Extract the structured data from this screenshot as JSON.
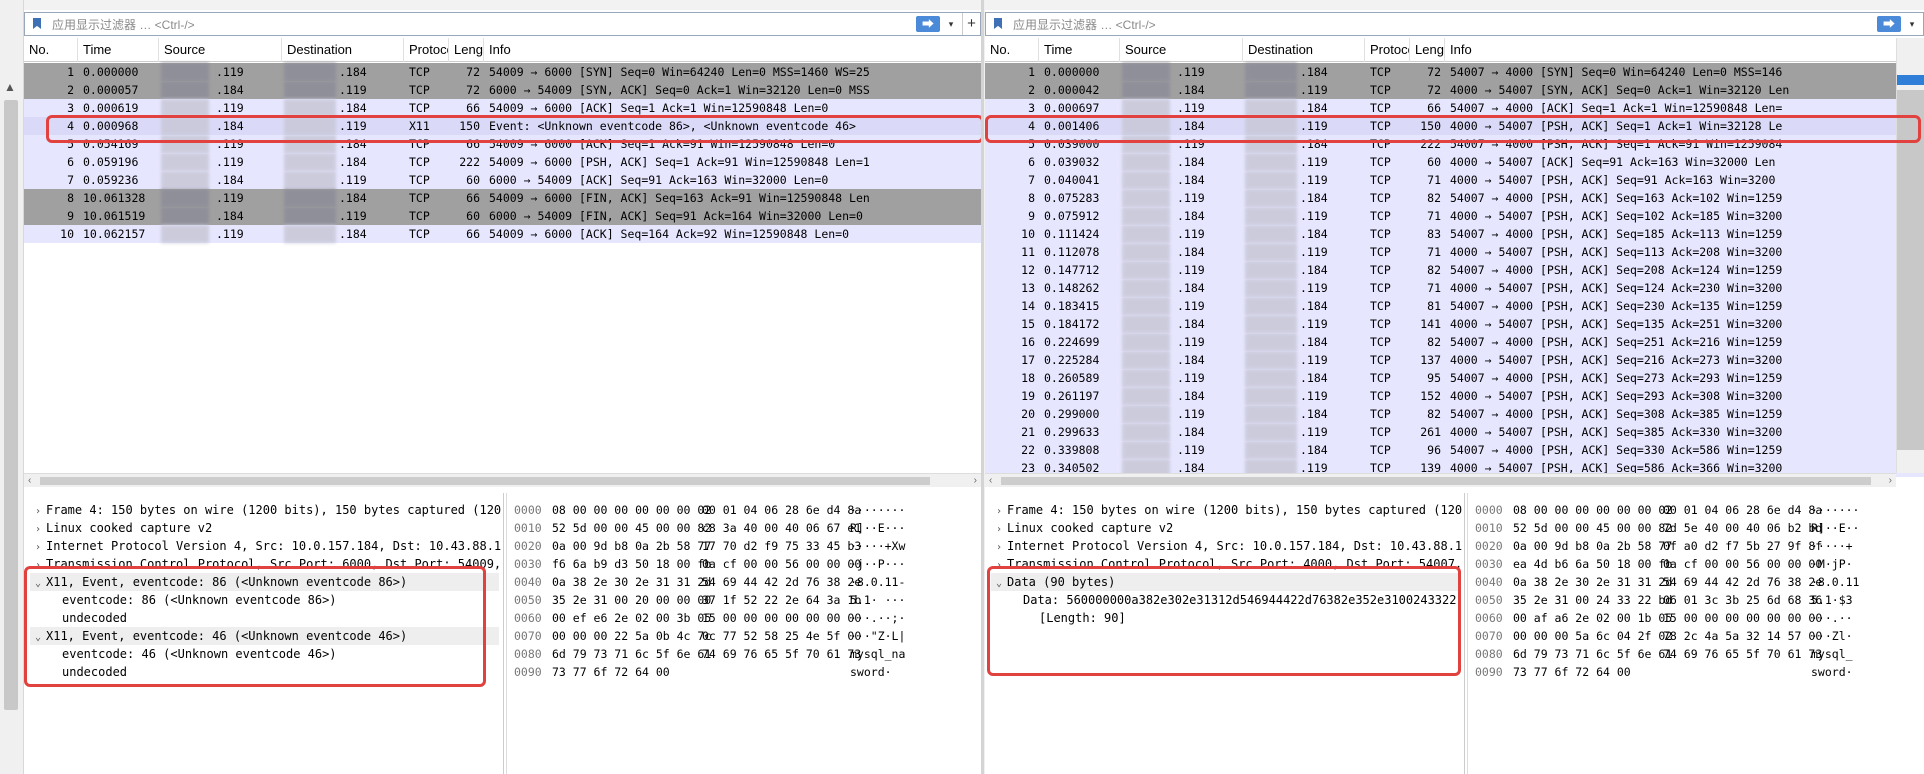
{
  "filter": {
    "placeholder": "应用显示过滤器 … <Ctrl-/>",
    "go_label": "⮕",
    "dropdown_label": "▾",
    "plus_label": "+"
  },
  "columns": [
    "No.",
    "Time",
    "Source",
    "Destination",
    "Protoco",
    "Lengt",
    "Info"
  ],
  "left_packets": [
    {
      "no": "1",
      "time": "0.000000",
      "src": ".119",
      "dst": ".184",
      "proto": "TCP",
      "len": "72",
      "info": "54009 → 6000 [SYN] Seq=0 Win=64240 Len=0 MSS=1460 WS=25",
      "style": "fin"
    },
    {
      "no": "2",
      "time": "0.000057",
      "src": ".184",
      "dst": ".119",
      "proto": "TCP",
      "len": "72",
      "info": "6000 → 54009 [SYN, ACK] Seq=0 Ack=1 Win=32120 Len=0 MSS",
      "style": "fin"
    },
    {
      "no": "3",
      "time": "0.000619",
      "src": ".119",
      "dst": ".184",
      "proto": "TCP",
      "len": "66",
      "info": "54009 → 6000 [ACK] Seq=1 Ack=1 Win=12590848 Len=0",
      "style": "tcp"
    },
    {
      "no": "4",
      "time": "0.000968",
      "src": ".184",
      "dst": ".119",
      "proto": "X11",
      "len": "150",
      "info": "Event: <Unknown eventcode 86>, <Unknown eventcode 46>",
      "style": "x11"
    },
    {
      "no": "5",
      "time": "0.054169",
      "src": ".119",
      "dst": ".184",
      "proto": "TCP",
      "len": "66",
      "info": "54009 → 6000 [ACK] Seq=1 Ack=91 Win=12590848 Len=0",
      "style": "tcp"
    },
    {
      "no": "6",
      "time": "0.059196",
      "src": ".119",
      "dst": ".184",
      "proto": "TCP",
      "len": "222",
      "info": "54009 → 6000 [PSH, ACK] Seq=1 Ack=91 Win=12590848 Len=1",
      "style": "tcp"
    },
    {
      "no": "7",
      "time": "0.059236",
      "src": ".184",
      "dst": ".119",
      "proto": "TCP",
      "len": "60",
      "info": "6000 → 54009 [ACK] Seq=91 Ack=163 Win=32000 Len=0",
      "style": "tcp"
    },
    {
      "no": "8",
      "time": "10.061328",
      "src": ".119",
      "dst": ".184",
      "proto": "TCP",
      "len": "66",
      "info": "54009 → 6000 [FIN, ACK] Seq=163 Ack=91 Win=12590848 Len",
      "style": "fin"
    },
    {
      "no": "9",
      "time": "10.061519",
      "src": ".184",
      "dst": ".119",
      "proto": "TCP",
      "len": "60",
      "info": "6000 → 54009 [FIN, ACK] Seq=91 Ack=164 Win=32000 Len=0",
      "style": "fin"
    },
    {
      "no": "10",
      "time": "10.062157",
      "src": ".119",
      "dst": ".184",
      "proto": "TCP",
      "len": "66",
      "info": "54009 → 6000 [ACK] Seq=164 Ack=92 Win=12590848 Len=0",
      "style": "tcp"
    }
  ],
  "right_packets": [
    {
      "no": "1",
      "time": "0.000000",
      "src": ".119",
      "dst": ".184",
      "proto": "TCP",
      "len": "72",
      "info": "54007 → 4000 [SYN] Seq=0 Win=64240 Len=0 MSS=146",
      "style": "fin"
    },
    {
      "no": "2",
      "time": "0.000042",
      "src": ".184",
      "dst": ".119",
      "proto": "TCP",
      "len": "72",
      "info": "4000 → 54007 [SYN, ACK] Seq=0 Ack=1 Win=32120 Len",
      "style": "fin"
    },
    {
      "no": "3",
      "time": "0.000697",
      "src": ".119",
      "dst": ".184",
      "proto": "TCP",
      "len": "66",
      "info": "54007 → 4000 [ACK] Seq=1 Ack=1 Win=12590848 Len=",
      "style": "tcp"
    },
    {
      "no": "4",
      "time": "0.001406",
      "src": ".184",
      "dst": ".119",
      "proto": "TCP",
      "len": "150",
      "info": "4000 → 54007 [PSH, ACK] Seq=1 Ack=1 Win=32128 Le",
      "style": "sel"
    },
    {
      "no": "5",
      "time": "0.039000",
      "src": ".119",
      "dst": ".184",
      "proto": "TCP",
      "len": "222",
      "info": "54007 → 4000 [PSH, ACK] Seq=1 Ack=91 Win=1259084",
      "style": "tcp"
    },
    {
      "no": "6",
      "time": "0.039032",
      "src": ".184",
      "dst": ".119",
      "proto": "TCP",
      "len": "60",
      "info": "4000 → 54007 [ACK] Seq=91 Ack=163 Win=32000 Len",
      "style": "tcp"
    },
    {
      "no": "7",
      "time": "0.040041",
      "src": ".184",
      "dst": ".119",
      "proto": "TCP",
      "len": "71",
      "info": "4000 → 54007 [PSH, ACK] Seq=91 Ack=163 Win=3200",
      "style": "tcp"
    },
    {
      "no": "8",
      "time": "0.075283",
      "src": ".119",
      "dst": ".184",
      "proto": "TCP",
      "len": "82",
      "info": "54007 → 4000 [PSH, ACK] Seq=163 Ack=102 Win=1259",
      "style": "tcp"
    },
    {
      "no": "9",
      "time": "0.075912",
      "src": ".184",
      "dst": ".119",
      "proto": "TCP",
      "len": "71",
      "info": "4000 → 54007 [PSH, ACK] Seq=102 Ack=185 Win=3200",
      "style": "tcp"
    },
    {
      "no": "10",
      "time": "0.111424",
      "src": ".119",
      "dst": ".184",
      "proto": "TCP",
      "len": "83",
      "info": "54007 → 4000 [PSH, ACK] Seq=185 Ack=113 Win=1259",
      "style": "tcp"
    },
    {
      "no": "11",
      "time": "0.112078",
      "src": ".184",
      "dst": ".119",
      "proto": "TCP",
      "len": "71",
      "info": "4000 → 54007 [PSH, ACK] Seq=113 Ack=208 Win=3200",
      "style": "tcp"
    },
    {
      "no": "12",
      "time": "0.147712",
      "src": ".119",
      "dst": ".184",
      "proto": "TCP",
      "len": "82",
      "info": "54007 → 4000 [PSH, ACK] Seq=208 Ack=124 Win=1259",
      "style": "tcp"
    },
    {
      "no": "13",
      "time": "0.148262",
      "src": ".184",
      "dst": ".119",
      "proto": "TCP",
      "len": "71",
      "info": "4000 → 54007 [PSH, ACK] Seq=124 Ack=230 Win=3200",
      "style": "tcp"
    },
    {
      "no": "14",
      "time": "0.183415",
      "src": ".119",
      "dst": ".184",
      "proto": "TCP",
      "len": "81",
      "info": "54007 → 4000 [PSH, ACK] Seq=230 Ack=135 Win=1259",
      "style": "tcp"
    },
    {
      "no": "15",
      "time": "0.184172",
      "src": ".184",
      "dst": ".119",
      "proto": "TCP",
      "len": "141",
      "info": "4000 → 54007 [PSH, ACK] Seq=135 Ack=251 Win=3200",
      "style": "tcp"
    },
    {
      "no": "16",
      "time": "0.224699",
      "src": ".119",
      "dst": ".184",
      "proto": "TCP",
      "len": "82",
      "info": "54007 → 4000 [PSH, ACK] Seq=251 Ack=216 Win=1259",
      "style": "tcp"
    },
    {
      "no": "17",
      "time": "0.225284",
      "src": ".184",
      "dst": ".119",
      "proto": "TCP",
      "len": "137",
      "info": "4000 → 54007 [PSH, ACK] Seq=216 Ack=273 Win=3200",
      "style": "tcp"
    },
    {
      "no": "18",
      "time": "0.260589",
      "src": ".119",
      "dst": ".184",
      "proto": "TCP",
      "len": "95",
      "info": "54007 → 4000 [PSH, ACK] Seq=273 Ack=293 Win=1259",
      "style": "tcp"
    },
    {
      "no": "19",
      "time": "0.261197",
      "src": ".184",
      "dst": ".119",
      "proto": "TCP",
      "len": "152",
      "info": "4000 → 54007 [PSH, ACK] Seq=293 Ack=308 Win=3200",
      "style": "tcp"
    },
    {
      "no": "20",
      "time": "0.299000",
      "src": ".119",
      "dst": ".184",
      "proto": "TCP",
      "len": "82",
      "info": "54007 → 4000 [PSH, ACK] Seq=308 Ack=385 Win=1259",
      "style": "tcp"
    },
    {
      "no": "21",
      "time": "0.299633",
      "src": ".184",
      "dst": ".119",
      "proto": "TCP",
      "len": "261",
      "info": "4000 → 54007 [PSH, ACK] Seq=385 Ack=330 Win=3200",
      "style": "tcp"
    },
    {
      "no": "22",
      "time": "0.339808",
      "src": ".119",
      "dst": ".184",
      "proto": "TCP",
      "len": "96",
      "info": "54007 → 4000 [PSH, ACK] Seq=330 Ack=586 Win=1259",
      "style": "tcp"
    },
    {
      "no": "23",
      "time": "0.340502",
      "src": ".184",
      "dst": ".119",
      "proto": "TCP",
      "len": "139",
      "info": "4000 → 54007 [PSH, ACK] Seq=586 Ack=366 Win=3200",
      "style": "tcp"
    }
  ],
  "left_detail": [
    {
      "tw": "›",
      "text": "Frame 4: 150 bytes on wire (1200 bits), 150 bytes captured (120",
      "indent": 0
    },
    {
      "tw": "›",
      "text": "Linux cooked capture v2",
      "indent": 0
    },
    {
      "tw": "›",
      "text": "Internet Protocol Version 4, Src: 10.0.157.184, Dst: 10.43.88.1",
      "indent": 0
    },
    {
      "tw": "›",
      "text": "Transmission Control Protocol, Src Port: 6000, Dst Port: 54009,",
      "indent": 0
    },
    {
      "tw": "⌄",
      "text": "X11, Event, eventcode: 86 (<Unknown eventcode 86>)",
      "indent": 0,
      "shade": true
    },
    {
      "tw": "",
      "text": "eventcode: 86 (<Unknown eventcode 86>)",
      "indent": 1
    },
    {
      "tw": "",
      "text": "undecoded",
      "indent": 1
    },
    {
      "tw": "⌄",
      "text": "X11, Event, eventcode: 46 (<Unknown eventcode 46>)",
      "indent": 0,
      "shade": true
    },
    {
      "tw": "",
      "text": "eventcode: 46 (<Unknown eventcode 46>)",
      "indent": 1
    },
    {
      "tw": "",
      "text": "undecoded",
      "indent": 1
    }
  ],
  "right_detail": [
    {
      "tw": "›",
      "text": "Frame 4: 150 bytes on wire (1200 bits), 150 bytes captured (120",
      "indent": 0
    },
    {
      "tw": "›",
      "text": "Linux cooked capture v2",
      "indent": 0
    },
    {
      "tw": "›",
      "text": "Internet Protocol Version 4, Src: 10.0.157.184, Dst: 10.43.88.1",
      "indent": 0
    },
    {
      "tw": "›",
      "text": "Transmission Control Protocol, Src Port: 4000, Dst Port: 54007,",
      "indent": 0
    },
    {
      "tw": "⌄",
      "text": "Data (90 bytes)",
      "indent": 0,
      "shade": true
    },
    {
      "tw": "",
      "text": "Data: 560000000a382e302e31312d546944422d76382e352e3100243322",
      "indent": 1
    },
    {
      "tw": "",
      "text": "[Length: 90]",
      "indent": 2
    }
  ],
  "left_hex": [
    {
      "off": "0000",
      "a": "08 00 00 00 00 00 00 02",
      "b": "00 01 04 06 28 6e d4 8a",
      "asc": "········"
    },
    {
      "off": "0010",
      "a": "52 5d 00 00 45 00 00 82",
      "b": "c8 3a 40 00 40 06 67 e1",
      "asc": "R]··E···"
    },
    {
      "off": "0020",
      "a": "0a 00 9d b8 0a 2b 58 77",
      "b": "17 70 d2 f9 75 33 45 b3",
      "asc": "·····+Xw"
    },
    {
      "off": "0030",
      "a": "f6 6a b9 d3 50 18 00 fb",
      "b": "0a cf 00 00 56 00 00 00",
      "asc": "·j··P···"
    },
    {
      "off": "0040",
      "a": "0a 38 2e 30 2e 31 31 2d",
      "b": "54 69 44 42 2d 76 38 2e",
      "asc": "·8.0.11-"
    },
    {
      "off": "0050",
      "a": "35 2e 31 00 20 00 00 00",
      "b": "37 1f 52 22 2e 64 3a 1b",
      "asc": "5.1· ···"
    },
    {
      "off": "0060",
      "a": "00 ef e6 2e 02 00 3b 05",
      "b": "15 00 00 00 00 00 00 00",
      "asc": "···.··;·"
    },
    {
      "off": "0070",
      "a": "00 00 00 22 5a 0b 4c 7c",
      "b": "0c 77 52 58 25 4e 5f 00",
      "asc": "···\"Z·L|"
    },
    {
      "off": "0080",
      "a": "6d 79 73 71 6c 5f 6e 61",
      "b": "74 69 76 65 5f 70 61 73",
      "asc": "mysql_na"
    },
    {
      "off": "0090",
      "a": "73 77 6f 72 64 00",
      "b": "",
      "asc": "sword·"
    }
  ],
  "right_hex": [
    {
      "off": "0000",
      "a": "08 00 00 00 00 00 00 02",
      "b": "00 01 04 06 28 6e d4 8a",
      "asc": "·······"
    },
    {
      "off": "0010",
      "a": "52 5d 00 00 45 00 00 82",
      "b": "7d 5e 40 00 40 06 b2 bd",
      "asc": "R]··E··"
    },
    {
      "off": "0020",
      "a": "0a 00 9d b8 0a 2b 58 77",
      "b": "0f a0 d2 f7 5b 27 9f 8f",
      "asc": "·····+"
    },
    {
      "off": "0030",
      "a": "ea 4d b6 6a 50 18 00 fb",
      "b": "0a cf 00 00 56 00 00 00",
      "asc": "·M·jP·"
    },
    {
      "off": "0040",
      "a": "0a 38 2e 30 2e 31 31 2d",
      "b": "54 69 44 42 2d 76 38 2e",
      "asc": "·8.0.11"
    },
    {
      "off": "0050",
      "a": "35 2e 31 00 24 33 22 bd",
      "b": "06 01 3c 3b 25 6d 68 36",
      "asc": "5.1·$3"
    },
    {
      "off": "0060",
      "a": "00 af a6 2e 02 00 1b 05",
      "b": "15 00 00 00 00 00 00 00",
      "asc": "···.··"
    },
    {
      "off": "0070",
      "a": "00 00 00 5a 6c 04 2f 02",
      "b": "78 2c 4a 5a 32 14 57 00",
      "asc": "···Zl·"
    },
    {
      "off": "0080",
      "a": "6d 79 73 71 6c 5f 6e 61",
      "b": "74 69 76 65 5f 70 61 73",
      "asc": "mysql_"
    },
    {
      "off": "0090",
      "a": "73 77 6f 72 64 00",
      "b": "",
      "asc": "sword·"
    }
  ],
  "colors": {
    "tcp_row": "#e7e6ff",
    "fin_row": "#a0a0a0",
    "highlight_box": "#e1413f",
    "filter_go": "#4a8ad8"
  }
}
